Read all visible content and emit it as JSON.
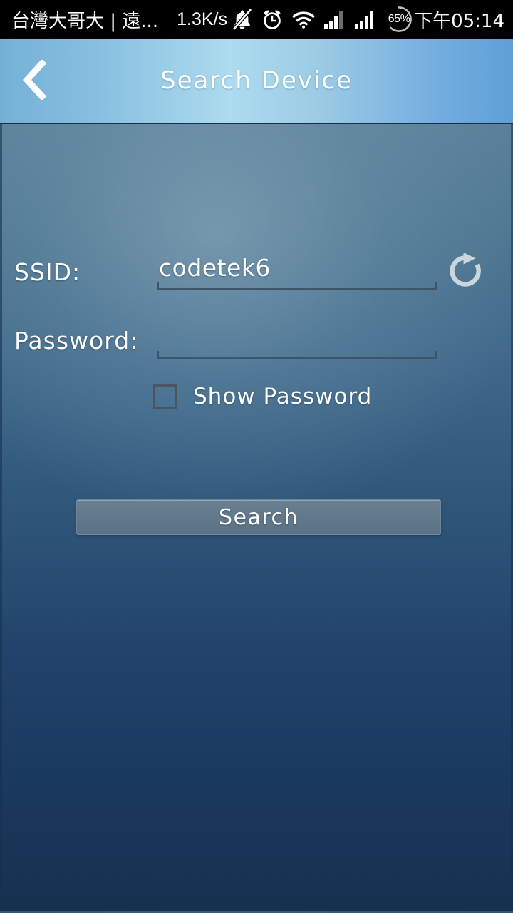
{
  "status_bar": {
    "carrier": "台灣大哥大 | 遠...",
    "network_speed": "1.3K/s",
    "battery_percent": "65%",
    "time": "下午05:14",
    "icons": [
      "bell-muted-icon",
      "alarm-clock-icon",
      "wifi-icon",
      "signal-bars-sim1-icon",
      "signal-bars-sim2-icon",
      "battery-ring-icon"
    ]
  },
  "header": {
    "title": "Search Device",
    "back_icon": "chevron-left-icon"
  },
  "form": {
    "ssid": {
      "label": "SSID:",
      "value": "codetek6",
      "placeholder": ""
    },
    "password": {
      "label": "Password:",
      "value": "",
      "placeholder": ""
    },
    "show_password": {
      "label": "Show Password",
      "checked": false
    },
    "refresh_icon": "refresh-icon"
  },
  "actions": {
    "search_label": "Search"
  },
  "colors": {
    "status_bar_bg": "#000000",
    "header_gradient_center": "#addbef",
    "header_gradient_edge": "#74b0d6",
    "content_top": "#5a8099",
    "content_bottom": "#16304f",
    "underline": "#3d5567",
    "checkbox_border": "#4a5560",
    "button_bg": "#63798c",
    "text": "#ffffff"
  }
}
